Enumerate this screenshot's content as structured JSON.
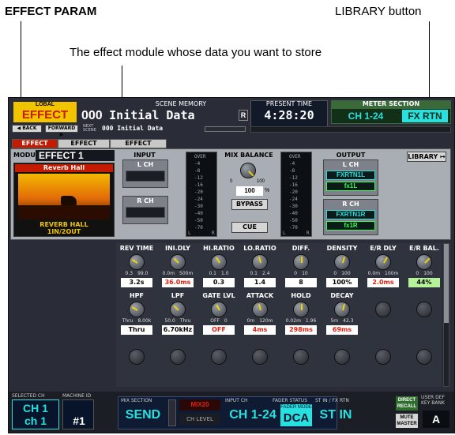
{
  "annotations": {
    "effect_param": "EFFECT PARAM",
    "library_button": "LIBRARY button",
    "module_desc": "The effect module whose data you want to store"
  },
  "header": {
    "global_label": "LOBAL",
    "screen_title": "EFFECT",
    "back": "◀ BACK",
    "forward": "FORWARD ▶",
    "scene_memory_label": "SCENE MEMORY",
    "scene_number": "000",
    "scene_name": "Initial Data",
    "r_badge": "R",
    "next_label": "NEXT SCENE",
    "next_number": "000",
    "next_name": "Initial Data",
    "present_time_label": "PRESENT TIME",
    "time": "4:28:20",
    "meter_section_label": "METER SECTION",
    "meter_ch": "CH 1-24",
    "meter_fx": "FX RTN"
  },
  "tabs": [
    "EFFECT PARAM",
    "EFFECT ASSIGN",
    "EFFECT LIBRARY"
  ],
  "module": {
    "label": "MODULE",
    "value": "EFFECT  1",
    "effect_name": "Reverb Hall",
    "effect_type": "REVERB HALL",
    "io": "1IN/2OUT"
  },
  "library_button": "LIBRARY ↦",
  "input": {
    "label": "INPUT",
    "lch": "L CH",
    "rch": "R CH",
    "meter_ticks": [
      "OVER",
      "-4",
      "-8",
      "-12",
      "-16",
      "-20",
      "-24",
      "-30",
      "-40",
      "-50",
      "-70"
    ],
    "meter_lr": [
      "L",
      "R"
    ]
  },
  "mix_balance": {
    "label": "MIX BALANCE",
    "range_min": "0",
    "range_max": "100",
    "value": "100",
    "unit": "%",
    "bypass": "BYPASS",
    "cue": "CUE"
  },
  "output": {
    "label": "OUTPUT",
    "lch": "L CH",
    "rch": "R CH",
    "l_assign": "FXRTN1L",
    "l_port": "fx1L",
    "r_assign": "FXRTN1R",
    "r_port": "fx1R"
  },
  "params_row1": [
    {
      "label": "REV TIME",
      "min": "0.3",
      "max": "99.0",
      "value": "3.2s",
      "style": ""
    },
    {
      "label": "INI.DLY",
      "min": "0.0m",
      "max": "500m",
      "value": "36.0ms",
      "style": "red"
    },
    {
      "label": "HI.RATIO",
      "min": "0.1",
      "max": "1.0",
      "value": "0.3",
      "style": ""
    },
    {
      "label": "LO.RATIO",
      "min": "0.1",
      "max": "2.4",
      "value": "1.4",
      "style": ""
    },
    {
      "label": "DIFF.",
      "min": "0",
      "max": "10",
      "value": "8",
      "style": ""
    },
    {
      "label": "DENSITY",
      "min": "0",
      "max": "100",
      "value": "100%",
      "style": ""
    },
    {
      "label": "E/R DLY",
      "min": "0.0m",
      "max": "100m",
      "value": "2.0ms",
      "style": "red"
    },
    {
      "label": "E/R BAL.",
      "min": "0",
      "max": "100",
      "value": "44%",
      "style": "green"
    }
  ],
  "params_row2": [
    {
      "label": "HPF",
      "min": "Thru",
      "max": "8.00k",
      "value": "Thru",
      "style": ""
    },
    {
      "label": "LPF",
      "min": "50.0",
      "max": "Thru",
      "value": "6.70kHz",
      "style": ""
    },
    {
      "label": "GATE LVL",
      "min": "OFF",
      "max": "0",
      "value": "OFF",
      "style": "red"
    },
    {
      "label": "ATTACK",
      "min": "0m",
      "max": "120m",
      "value": "4ms",
      "style": "red"
    },
    {
      "label": "HOLD",
      "min": "0.02m",
      "max": "1.96",
      "value": "298ms",
      "style": "red"
    },
    {
      "label": "DECAY",
      "min": "5m",
      "max": "42.3",
      "value": "69ms",
      "style": "red"
    }
  ],
  "footer": {
    "selected_ch_label": "SELECTED CH",
    "selected_ch": "CH 1",
    "selected_ch_name": "ch 1",
    "machine_id_label": "MACHINE ID",
    "machine_id": "#1",
    "mix_section_label": "MIX SECTION",
    "send": "SEND",
    "mix_name": "MIX20",
    "ch_level": "CH LEVEL",
    "input_ch_label": "INPUT CH",
    "input_ch": "CH 1-24",
    "fader_status_label": "FADER STATUS",
    "fader_mode_label": "FADER MODE",
    "fader_mode": "DCA",
    "st_in_label": "ST IN / FX RTN",
    "st_in": "ST IN",
    "direct_recall": "DIRECT RECALL",
    "mute_master": "MUTE MASTER",
    "user_def_label": "USER DEF KEY BANK",
    "bank": "A"
  }
}
